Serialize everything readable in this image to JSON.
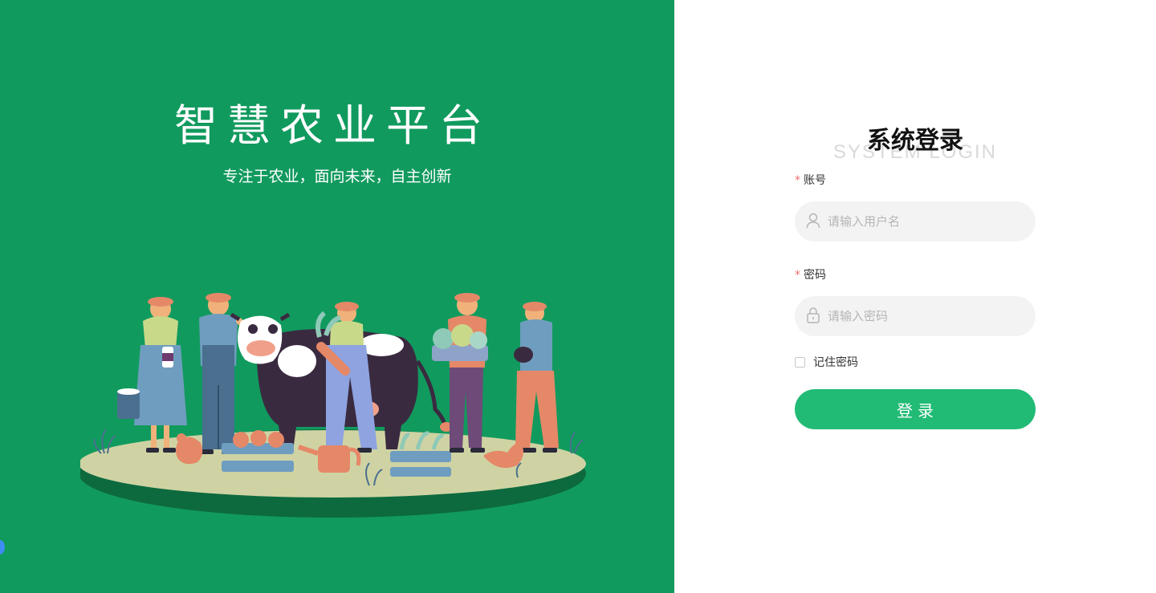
{
  "brand": {
    "title": "智慧农业平台",
    "subtitle": "专注于农业，面向未来，自主创新"
  },
  "login": {
    "title": "系统登录",
    "subtitle": "SYSTEM LOGIN",
    "account": {
      "required_mark": "*",
      "label": "账号",
      "placeholder": "请输入用户名",
      "icon": "user-icon"
    },
    "password": {
      "required_mark": "*",
      "label": "密码",
      "placeholder": "请输入密码",
      "icon": "lock-icon"
    },
    "remember_label": "记住密码",
    "remember_checked": false,
    "submit_label": "登录"
  },
  "colors": {
    "brand_green": "#119a5e",
    "button_green": "#21bb75",
    "input_bg": "#f3f3f3",
    "required_red": "#f56c6c"
  }
}
